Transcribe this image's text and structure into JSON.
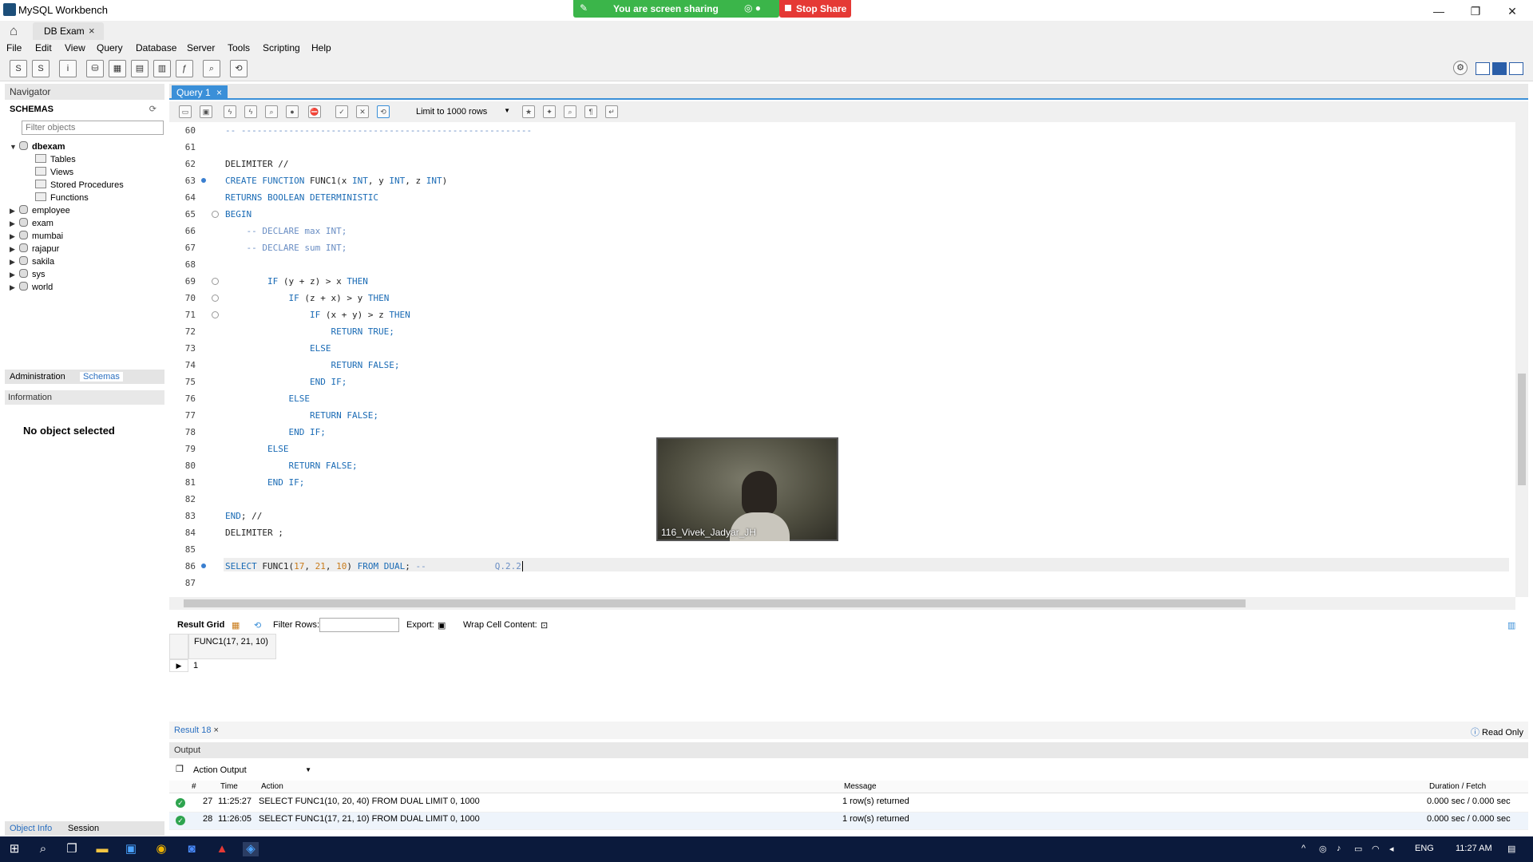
{
  "window": {
    "title": "MySQL Workbench",
    "minimize": "—",
    "restore": "❐",
    "close": "✕"
  },
  "screen_share": {
    "message": "You are screen sharing",
    "stop_label": "Stop Share"
  },
  "connection_tab": {
    "label": "DB Exam",
    "close": "×"
  },
  "menu": [
    "File",
    "Edit",
    "View",
    "Query",
    "Database",
    "Server",
    "Tools",
    "Scripting",
    "Help"
  ],
  "navigator": {
    "header": "Navigator",
    "schemas_label": "SCHEMAS",
    "filter_placeholder": "Filter objects",
    "active_schema": "dbexam",
    "schema_children": [
      "Tables",
      "Views",
      "Stored Procedures",
      "Functions"
    ],
    "other_schemas": [
      "employee",
      "exam",
      "mumbai",
      "rajapur",
      "sakila",
      "sys",
      "world"
    ],
    "tab_admin": "Administration",
    "tab_schemas": "Schemas",
    "info_header": "Information",
    "no_object": "No object selected",
    "tab_object_info": "Object Info",
    "tab_session": "Session"
  },
  "query_tab": {
    "label": "Query 1",
    "close": "×"
  },
  "editor_toolbar": {
    "limit_label": "Limit to 1000 rows"
  },
  "editor": {
    "lines": [
      {
        "n": "60",
        "text": "-- -------------------------------------------------------"
      },
      {
        "n": "61",
        "text": ""
      },
      {
        "n": "62",
        "text": "DELIMITER //"
      },
      {
        "n": "63",
        "text": "CREATE FUNCTION FUNC1(x INT, y INT, z INT)"
      },
      {
        "n": "64",
        "text": "RETURNS BOOLEAN DETERMINISTIC"
      },
      {
        "n": "65",
        "text": "BEGIN"
      },
      {
        "n": "66",
        "text": "    -- DECLARE max INT;"
      },
      {
        "n": "67",
        "text": "    -- DECLARE sum INT;"
      },
      {
        "n": "68",
        "text": ""
      },
      {
        "n": "69",
        "text": "        IF (y + z) > x THEN"
      },
      {
        "n": "70",
        "text": "            IF (z + x) > y THEN"
      },
      {
        "n": "71",
        "text": "                IF (x + y) > z THEN"
      },
      {
        "n": "72",
        "text": "                    RETURN TRUE;"
      },
      {
        "n": "73",
        "text": "                ELSE"
      },
      {
        "n": "74",
        "text": "                    RETURN FALSE;"
      },
      {
        "n": "75",
        "text": "                END IF;"
      },
      {
        "n": "76",
        "text": "            ELSE"
      },
      {
        "n": "77",
        "text": "                RETURN FALSE;"
      },
      {
        "n": "78",
        "text": "            END IF;"
      },
      {
        "n": "79",
        "text": "        ELSE"
      },
      {
        "n": "80",
        "text": "            RETURN FALSE;"
      },
      {
        "n": "81",
        "text": "        END IF;"
      },
      {
        "n": "82",
        "text": ""
      },
      {
        "n": "83",
        "text": "END; //"
      },
      {
        "n": "84",
        "text": "DELIMITER ;"
      },
      {
        "n": "85",
        "text": ""
      },
      {
        "n": "86",
        "text": "SELECT FUNC1(17, 21, 10) FROM DUAL; --             Q.2.2"
      },
      {
        "n": "87",
        "text": ""
      }
    ]
  },
  "video": {
    "participant": "116_Vivek_Jadyar_JH"
  },
  "result_toolbar": {
    "result_grid": "Result Grid",
    "filter_rows": "Filter Rows:",
    "export": "Export:",
    "wrap": "Wrap Cell Content:"
  },
  "result_grid": {
    "column": "FUNC1(17, 21, 10)",
    "value": "1"
  },
  "result_tab": {
    "label": "Result 18",
    "close": "×",
    "read_only": "Read Only"
  },
  "output": {
    "header": "Output",
    "selector": "Action Output",
    "columns": [
      "#",
      "Time",
      "Action",
      "Message",
      "Duration / Fetch"
    ],
    "rows": [
      {
        "num": "27",
        "time": "11:25:27",
        "action": "SELECT FUNC1(10, 20, 40) FROM DUAL LIMIT 0, 1000",
        "message": "1 row(s) returned",
        "duration": "0.000 sec / 0.000 sec"
      },
      {
        "num": "28",
        "time": "11:26:05",
        "action": "SELECT FUNC1(17, 21, 10) FROM DUAL LIMIT 0, 1000",
        "message": "1 row(s) returned",
        "duration": "0.000 sec / 0.000 sec"
      }
    ]
  },
  "taskbar": {
    "language": "ENG",
    "time": "11:27 AM"
  }
}
